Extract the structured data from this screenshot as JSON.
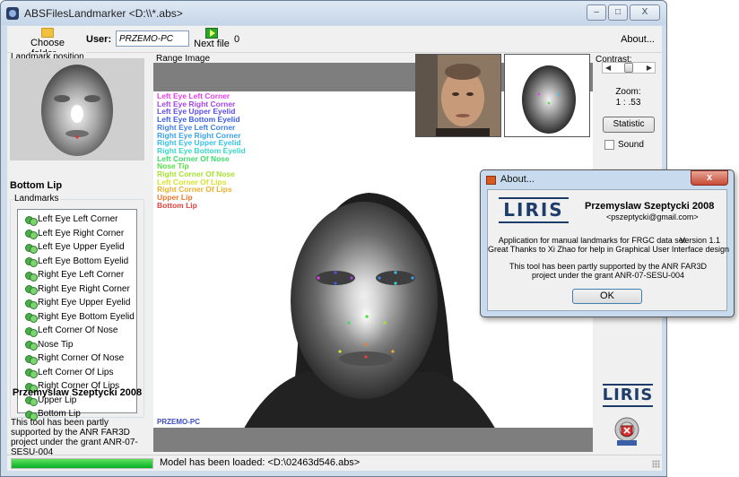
{
  "window": {
    "title": "ABSFilesLandmarker <D:\\\\*.abs>",
    "minimize": "–",
    "maximize": "□",
    "close": "X"
  },
  "toolbar": {
    "choose_folder": "Choose folder...",
    "user_label": "User:",
    "user_value": "PRZEMO-PC",
    "next_file": "Next file",
    "counter": "0",
    "about": "About..."
  },
  "left_panel": {
    "landmark_position_label": "Landmark position",
    "current_landmark": "Bottom Lip",
    "landmarks_label": "Landmarks",
    "landmarks": [
      "Left Eye Left Corner",
      "Left Eye Right Corner",
      "Left Eye Upper Eyelid",
      "Left Eye Bottom Eyelid",
      "Right Eye Left Corner",
      "Right Eye Right Corner",
      "Right Eye Upper Eyelid",
      "Right Eye Bottom Eyelid",
      "Left Corner Of Nose",
      "Nose Tip",
      "Right Corner Of Nose",
      "Left Corner Of Lips",
      "Right Corner Of Lips",
      "Upper Lip",
      "Bottom Lip"
    ],
    "author": "Przemyslaw Szeptycki 2008",
    "support_text": "This tool has been partly supported by the ANR FAR3D project under the grant ANR-07-SESU-004"
  },
  "range_image": {
    "label": "Range Image",
    "legend": [
      {
        "text": "Left Eye Left Corner",
        "color": "#e83fe8"
      },
      {
        "text": "Left Eye Right Corner",
        "color": "#a244e6"
      },
      {
        "text": "Left Eye Upper Eyelid",
        "color": "#5d4de9"
      },
      {
        "text": "Left Eye Bottom Eyelid",
        "color": "#3c5ce6"
      },
      {
        "text": "Right Eye Left Corner",
        "color": "#3f7fe8"
      },
      {
        "text": "Right Eye Right Corner",
        "color": "#3aa2ea"
      },
      {
        "text": "Right Eye Upper Eyelid",
        "color": "#37c2e6"
      },
      {
        "text": "Right Eye Bottom Eyelid",
        "color": "#36d8c8"
      },
      {
        "text": "Left Corner Of Nose",
        "color": "#3ddc6a"
      },
      {
        "text": "Nose Tip",
        "color": "#58e04a"
      },
      {
        "text": "Right Corner Of Nose",
        "color": "#a6e22f"
      },
      {
        "text": "Left Corner Of Lips",
        "color": "#d7e12c"
      },
      {
        "text": "Right Corner Of Lips",
        "color": "#e8b02c"
      },
      {
        "text": "Upper Lip",
        "color": "#ee7a2c"
      },
      {
        "text": "Bottom Lip",
        "color": "#ea3f3a"
      }
    ],
    "user_tag": "PRZEMO-PC"
  },
  "right_panel": {
    "contrast_label": "Contrast:",
    "zoom_label": "Zoom:",
    "zoom_value": "1 : .53",
    "statistic_button": "Statistic",
    "sound_label": "Sound",
    "logo": "LIRIS"
  },
  "status": {
    "progress_fraction": 1.0,
    "text": "Model has been loaded: <D:\\02463d546.abs>"
  },
  "about_dialog": {
    "title": "About...",
    "close": "x",
    "logo": "LIRIS",
    "author": "Przemyslaw Szeptycki 2008",
    "email": "<pszeptycki@gmail.com>",
    "description": "Application for manual landmarks for FRGC data set",
    "version": "Version 1.1",
    "thanks": "Great Thanks to Xi Zhao for help in Graphical User Interface design",
    "support_line1": "This tool has been partly supported by the ANR FAR3D",
    "support_line2": "project under the grant ANR-07-SESU-004",
    "ok": "OK"
  }
}
